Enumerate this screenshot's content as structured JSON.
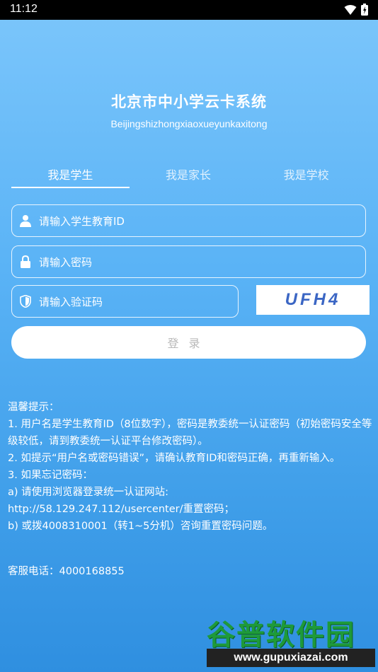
{
  "status_bar": {
    "time": "11:12"
  },
  "app": {
    "title": "北京市中小学云卡系统",
    "subtitle": "Beijingshizhongxiaoxueyunkaxitong"
  },
  "tabs": [
    {
      "label": "我是学生",
      "active": true
    },
    {
      "label": "我是家长",
      "active": false
    },
    {
      "label": "我是学校",
      "active": false
    }
  ],
  "form": {
    "student_id_placeholder": "请输入学生教育ID",
    "password_placeholder": "请输入密码",
    "captcha_placeholder": "请输入验证码",
    "captcha_text": "UFH4",
    "login_label": "登录"
  },
  "tips": {
    "heading": "温馨提示：",
    "lines": [
      "1. 用户名是学生教育ID（8位数字），密码是教委统一认证密码（初始密码安全等级较低，请到教委统一认证平台修改密码）。",
      "2. 如提示“用户名或密码错误”，请确认教育ID和密码正确，再重新输入。",
      "3. 如果忘记密码：",
      "a) 请使用浏览器登录统一认证网站:",
      "http://58.129.247.112/usercenter/重置密码；",
      "b) 或拨4008310001（转1~5分机）咨询重置密码问题。"
    ],
    "hotline": "客服电话：4000168855"
  },
  "watermark": {
    "text": "谷普软件园",
    "url": "www.gupuxiazai.com"
  },
  "colors": {
    "background_top": "#7cc6fb",
    "background_bottom": "#2f8fe0",
    "captcha_text": "#3b66c4"
  }
}
